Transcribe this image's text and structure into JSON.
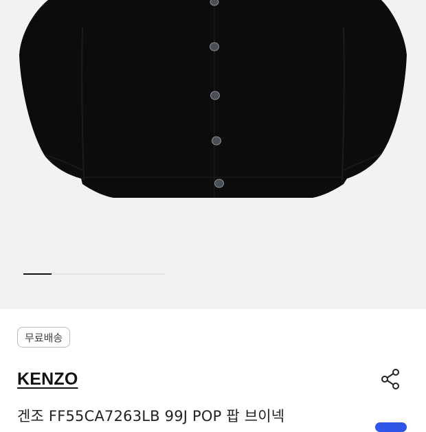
{
  "gallery": {
    "image": "black v-neck cardigan product photo",
    "current_slide_fraction": 0.2
  },
  "badge": {
    "label": "무료배송"
  },
  "product": {
    "brand": "KENZO",
    "title": "겐조 FF55CA7263LB 99J POP 팝 브이넥"
  },
  "icons": {
    "share": "share-icon"
  },
  "colors": {
    "garment": "#0c0c0d",
    "button_accent": "#2f56e6",
    "progress_active": "#111111"
  }
}
